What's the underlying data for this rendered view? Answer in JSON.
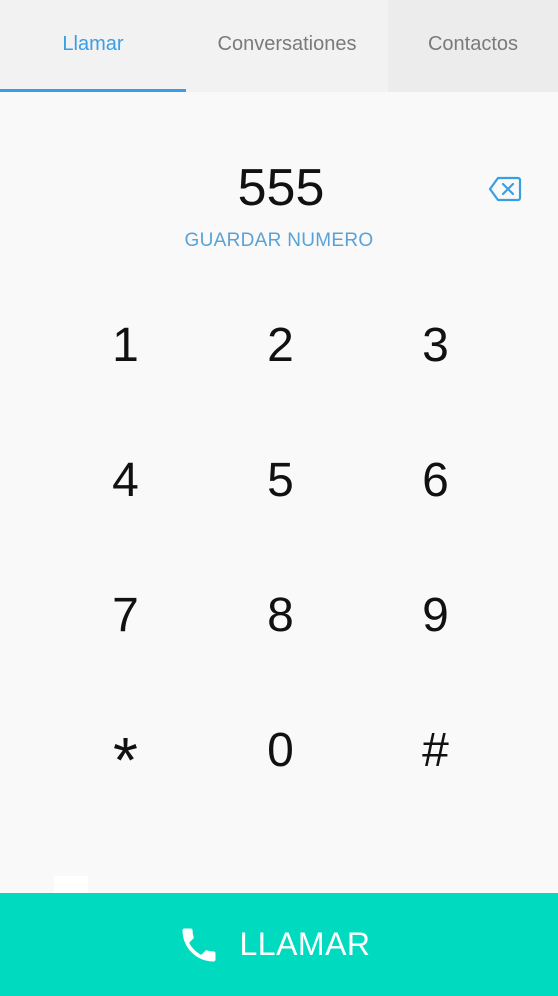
{
  "tabs": [
    {
      "label": "Llamar",
      "active": true
    },
    {
      "label": "Conversationes",
      "active": false
    },
    {
      "label": "Contactos",
      "active": false
    }
  ],
  "dialer": {
    "number": "555",
    "save_label": "GUARDAR NUMERO",
    "backspace_icon": "backspace-icon"
  },
  "keypad": {
    "keys": [
      "1",
      "2",
      "3",
      "4",
      "5",
      "6",
      "7",
      "8",
      "9",
      "*",
      "0",
      "#"
    ]
  },
  "call_button": {
    "label": "LLAMAR",
    "icon": "phone-icon"
  },
  "colors": {
    "accent": "#3a9ee6",
    "call_bar": "#00dbc0",
    "save_link": "#5aa2d6"
  }
}
